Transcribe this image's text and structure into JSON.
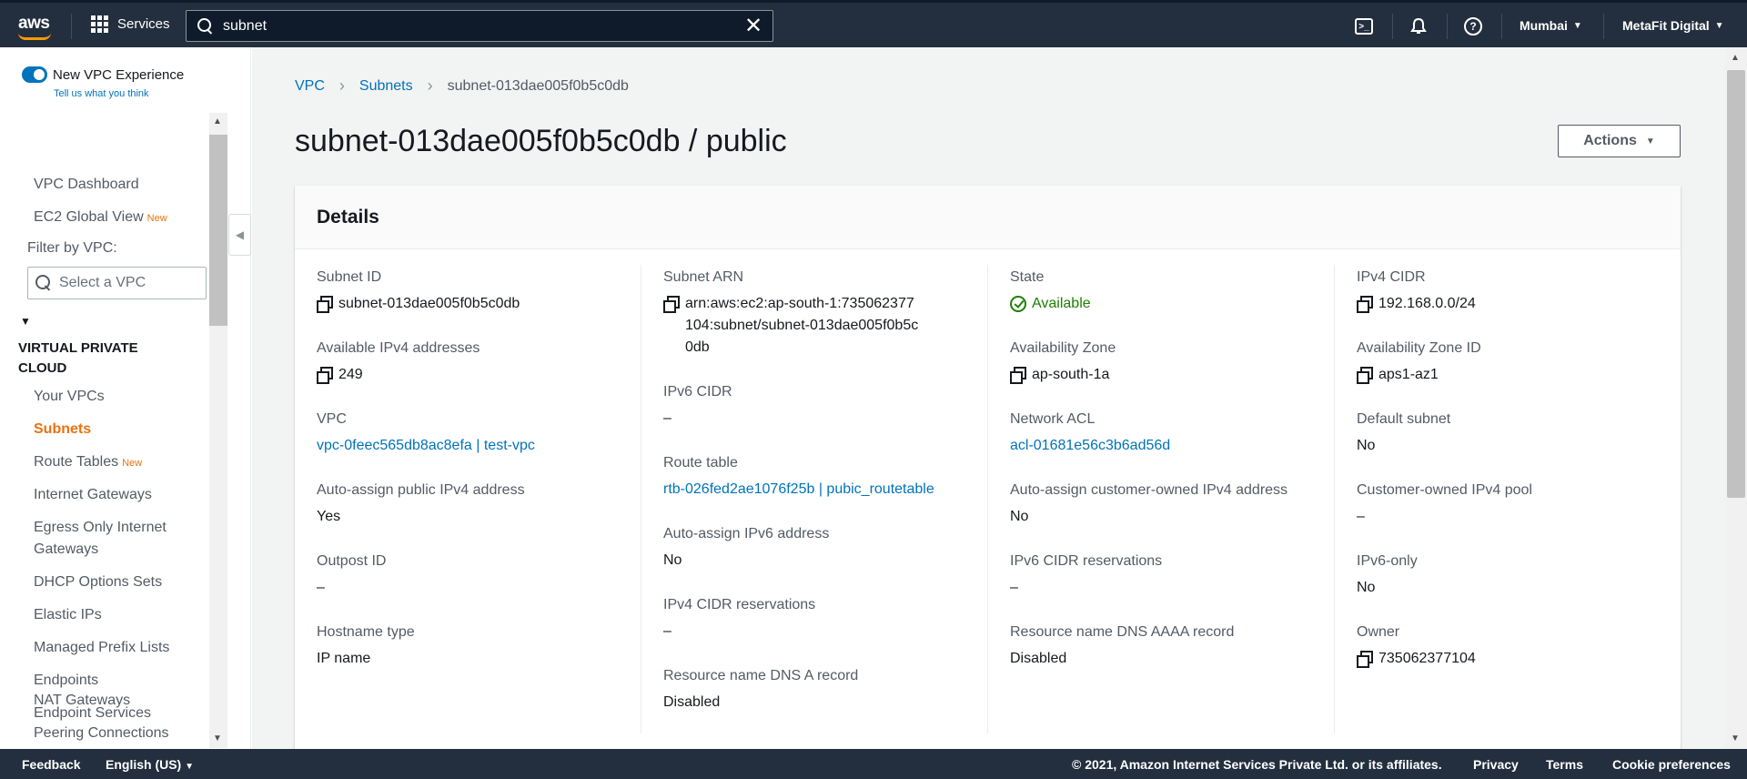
{
  "topnav": {
    "logo": "aws",
    "services": "Services",
    "search_value": "subnet",
    "region": "Mumbai",
    "account": "MetaFit Digital"
  },
  "sidebar": {
    "new_experience": "New VPC Experience",
    "tell_us": "Tell us what you think",
    "vpc_dashboard": "VPC Dashboard",
    "ec2_global_view": "EC2 Global View",
    "new_badge": "New",
    "filter_label": "Filter by VPC:",
    "filter_placeholder": "Select a VPC",
    "section_title": "VIRTUAL PRIVATE CLOUD",
    "items": [
      {
        "label": "Your VPCs"
      },
      {
        "label": "Subnets"
      },
      {
        "label": "Route Tables"
      },
      {
        "label": "Internet Gateways"
      },
      {
        "label": "Egress Only Internet Gateways"
      },
      {
        "label": "DHCP Options Sets"
      },
      {
        "label": "Elastic IPs"
      },
      {
        "label": "Managed Prefix Lists"
      },
      {
        "label": "Endpoints"
      },
      {
        "label": "Endpoint Services"
      },
      {
        "label": "NAT Gateways"
      },
      {
        "label": "Peering Connections"
      }
    ]
  },
  "breadcrumb": {
    "vpc": "VPC",
    "subnets": "Subnets",
    "current": "subnet-013dae005f0b5c0db"
  },
  "page": {
    "title": "subnet-013dae005f0b5c0db / public",
    "actions": "Actions",
    "details_title": "Details"
  },
  "details": {
    "col1": [
      {
        "label": "Subnet ID",
        "value": "subnet-013dae005f0b5c0db"
      },
      {
        "label": "Available IPv4 addresses",
        "value": "249"
      },
      {
        "label": "VPC",
        "value": "vpc-0feec565db8ac8efa | test-vpc"
      },
      {
        "label": "Auto-assign public IPv4 address",
        "value": "Yes"
      },
      {
        "label": "Outpost ID",
        "value": "–"
      },
      {
        "label": "Hostname type",
        "value": "IP name"
      }
    ],
    "col2": [
      {
        "label": "Subnet ARN",
        "value": "arn:aws:ec2:ap-south-1:735062377104:subnet/subnet-013dae005f0b5c0db"
      },
      {
        "label": "IPv6 CIDR",
        "value": "–"
      },
      {
        "label": "Route table",
        "value": "rtb-026fed2ae1076f25b | pubic_routetable"
      },
      {
        "label": "Auto-assign IPv6 address",
        "value": "No"
      },
      {
        "label": "IPv4 CIDR reservations",
        "value": "–"
      },
      {
        "label": "Resource name DNS A record",
        "value": "Disabled"
      }
    ],
    "col3": [
      {
        "label": "State",
        "value": "Available"
      },
      {
        "label": "Availability Zone",
        "value": "ap-south-1a"
      },
      {
        "label": "Network ACL",
        "value": "acl-01681e56c3b6ad56d"
      },
      {
        "label": "Auto-assign customer-owned IPv4 address",
        "value": "No"
      },
      {
        "label": "IPv6 CIDR reservations",
        "value": "–"
      },
      {
        "label": "Resource name DNS AAAA record",
        "value": "Disabled"
      }
    ],
    "col4": [
      {
        "label": "IPv4 CIDR",
        "value": "192.168.0.0/24"
      },
      {
        "label": "Availability Zone ID",
        "value": "aps1-az1"
      },
      {
        "label": "Default subnet",
        "value": "No"
      },
      {
        "label": "Customer-owned IPv4 pool",
        "value": "–"
      },
      {
        "label": "IPv6-only",
        "value": "No"
      },
      {
        "label": "Owner",
        "value": "735062377104"
      }
    ]
  },
  "footer": {
    "feedback": "Feedback",
    "language": "English (US)",
    "copyright": "© 2021, Amazon Internet Services Private Ltd. or its affiliates.",
    "privacy": "Privacy",
    "terms": "Terms",
    "cookies": "Cookie preferences"
  },
  "colors": {
    "nav_bg": "#232f3e",
    "link": "#0073bb",
    "accent_orange": "#ec7211",
    "status_green": "#1d8102"
  }
}
